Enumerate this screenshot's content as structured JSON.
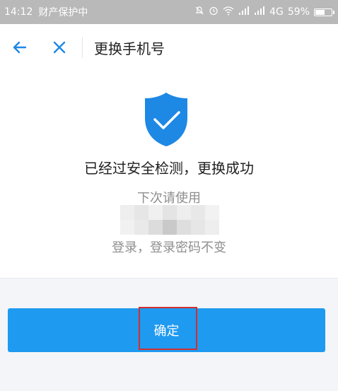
{
  "status_bar": {
    "time": "14:12",
    "carrier_label": "财产保护中",
    "network": "4G",
    "battery": "59%",
    "battery_level": 0.59,
    "icons": [
      "mute-icon",
      "alarm-icon",
      "wifi-icon",
      "signal-icon",
      "signal-icon",
      "battery-icon"
    ]
  },
  "nav": {
    "title": "更换手机号",
    "back_icon": "arrow-left-icon",
    "close_icon": "close-icon",
    "accent_color": "#1e88e5"
  },
  "main": {
    "shield_icon": "shield-check-icon",
    "shield_color": "#1e88e5",
    "headline": "已经过安全检测，更换成功",
    "subline_before": "下次请使用",
    "subline_after": "登录，登录密码不变"
  },
  "actions": {
    "confirm_label": "确定",
    "button_color": "#1e9af0",
    "highlight_color": "#d22f2f"
  }
}
